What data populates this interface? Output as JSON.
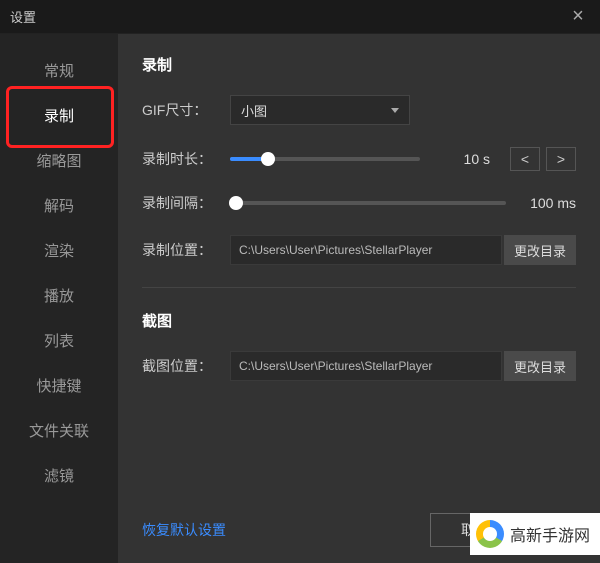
{
  "titlebar": {
    "title": "设置"
  },
  "sidebar": {
    "items": [
      {
        "label": "常规"
      },
      {
        "label": "录制"
      },
      {
        "label": "缩略图"
      },
      {
        "label": "解码"
      },
      {
        "label": "渲染"
      },
      {
        "label": "播放"
      },
      {
        "label": "列表"
      },
      {
        "label": "快捷键"
      },
      {
        "label": "文件关联"
      },
      {
        "label": "滤镜"
      }
    ],
    "active_index": 1
  },
  "main": {
    "record": {
      "title": "录制",
      "gif_size_label": "GIF尺寸：",
      "gif_size_value": "小图",
      "duration_label": "录制时长：",
      "duration_value": "10",
      "duration_unit": "s",
      "duration_fill_pct": 20,
      "interval_label": "录制间隔：",
      "interval_value": "100",
      "interval_unit": "ms",
      "interval_fill_pct": 2,
      "location_label": "录制位置：",
      "location_path": "C:\\Users\\User\\Pictures\\StellarPlayer",
      "change_dir_label": "更改目录"
    },
    "screenshot": {
      "title": "截图",
      "location_label": "截图位置：",
      "location_path": "C:\\Users\\User\\Pictures\\StellarPlayer",
      "change_dir_label": "更改目录"
    }
  },
  "footer": {
    "reset_label": "恢复默认设置",
    "cancel_label": "取消"
  },
  "watermark": {
    "text": "高新手游网"
  }
}
